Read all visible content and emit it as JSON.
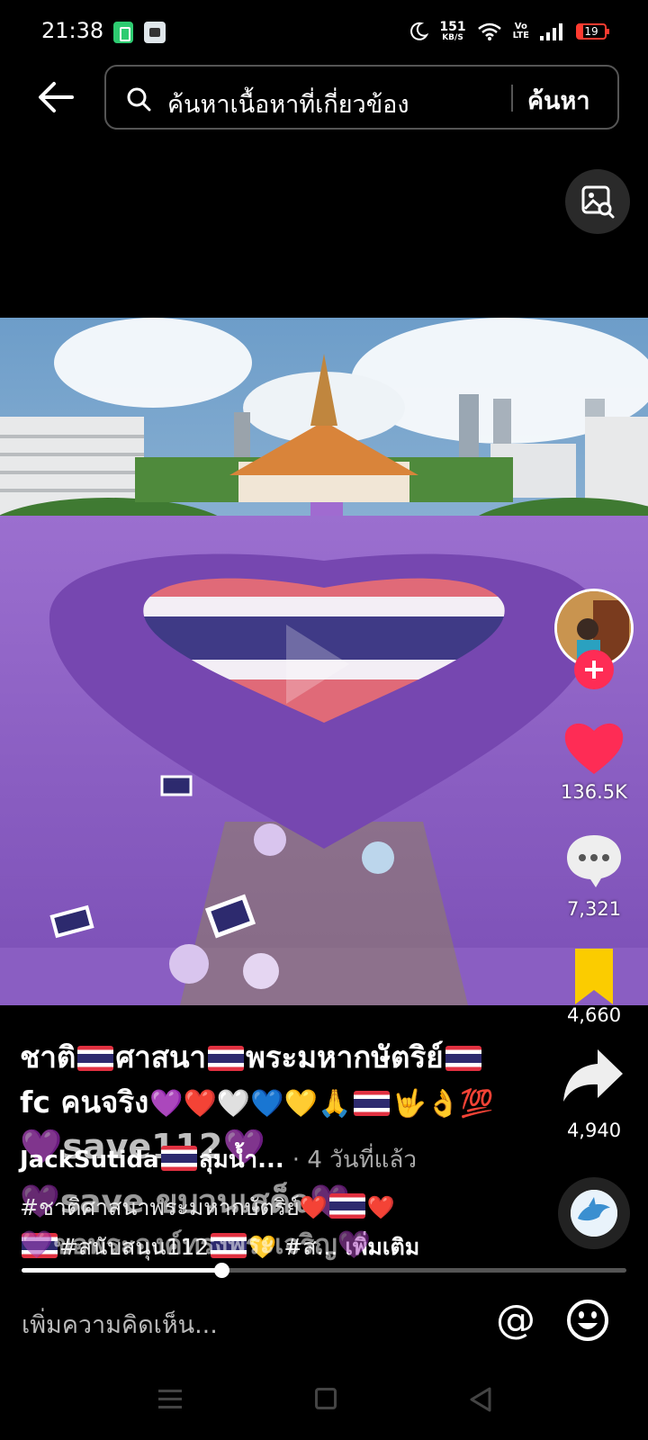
{
  "status_bar": {
    "time": "21:38",
    "net_speed_value": "151",
    "net_speed_unit": "KB/S",
    "volte_top": "Vo",
    "volte_bottom": "LTE",
    "battery": "19",
    "icons": [
      "battery-saver-icon",
      "screenshot-icon",
      "moon-icon",
      "wifi-icon",
      "signal-icon"
    ]
  },
  "header": {
    "back_icon": "arrow-left-icon",
    "search_placeholder": "ค้นหาเนื้อหาที่เกี่ยวข้อง",
    "search_button": "ค้นหา",
    "image_search_icon": "image-search-icon"
  },
  "rail": {
    "likes": "136.5K",
    "comments": "7,321",
    "saves": "4,660",
    "shares": "4,940",
    "like_color": "#fe2c55",
    "save_color": "#fbcc00",
    "follow_color": "#fe2c55"
  },
  "caption": {
    "line1_parts": [
      "ชาติ",
      "ศาสนา",
      "พระมหากษัตริย์"
    ],
    "line2_text": "fc คนจริง",
    "line2_emojis": "💜❤️🤍💙💛🙏",
    "line2_tail": "🤟👌💯",
    "author": "JackSutida",
    "author_suffix": "ลุ่มน้ำ...",
    "time_ago": "· 4 วันที่แล้ว",
    "overlay_line1": "💜save112💜",
    "overlay_line2": "💜save ขบวนเสด็จ💜",
    "overlay_line3": "💜ขอพระองค์ทรงพระเจริญ💜",
    "hashtags_line1": "#ชาติศาสนาพระมหากษัตริย์❤️",
    "hashtags_line2": "#สนับสนุน112",
    "hashtags_line2b": "💛 #ส...",
    "more": "เพิ่มเติม"
  },
  "progress": {
    "fraction": 0.33
  },
  "comment_bar": {
    "placeholder": "เพิ่มความคิดเห็น...",
    "mention": "@",
    "emoji_icon": "smiley-icon"
  },
  "nav": {
    "icons": [
      "menu-icon",
      "home-icon",
      "back-triangle-icon"
    ]
  }
}
